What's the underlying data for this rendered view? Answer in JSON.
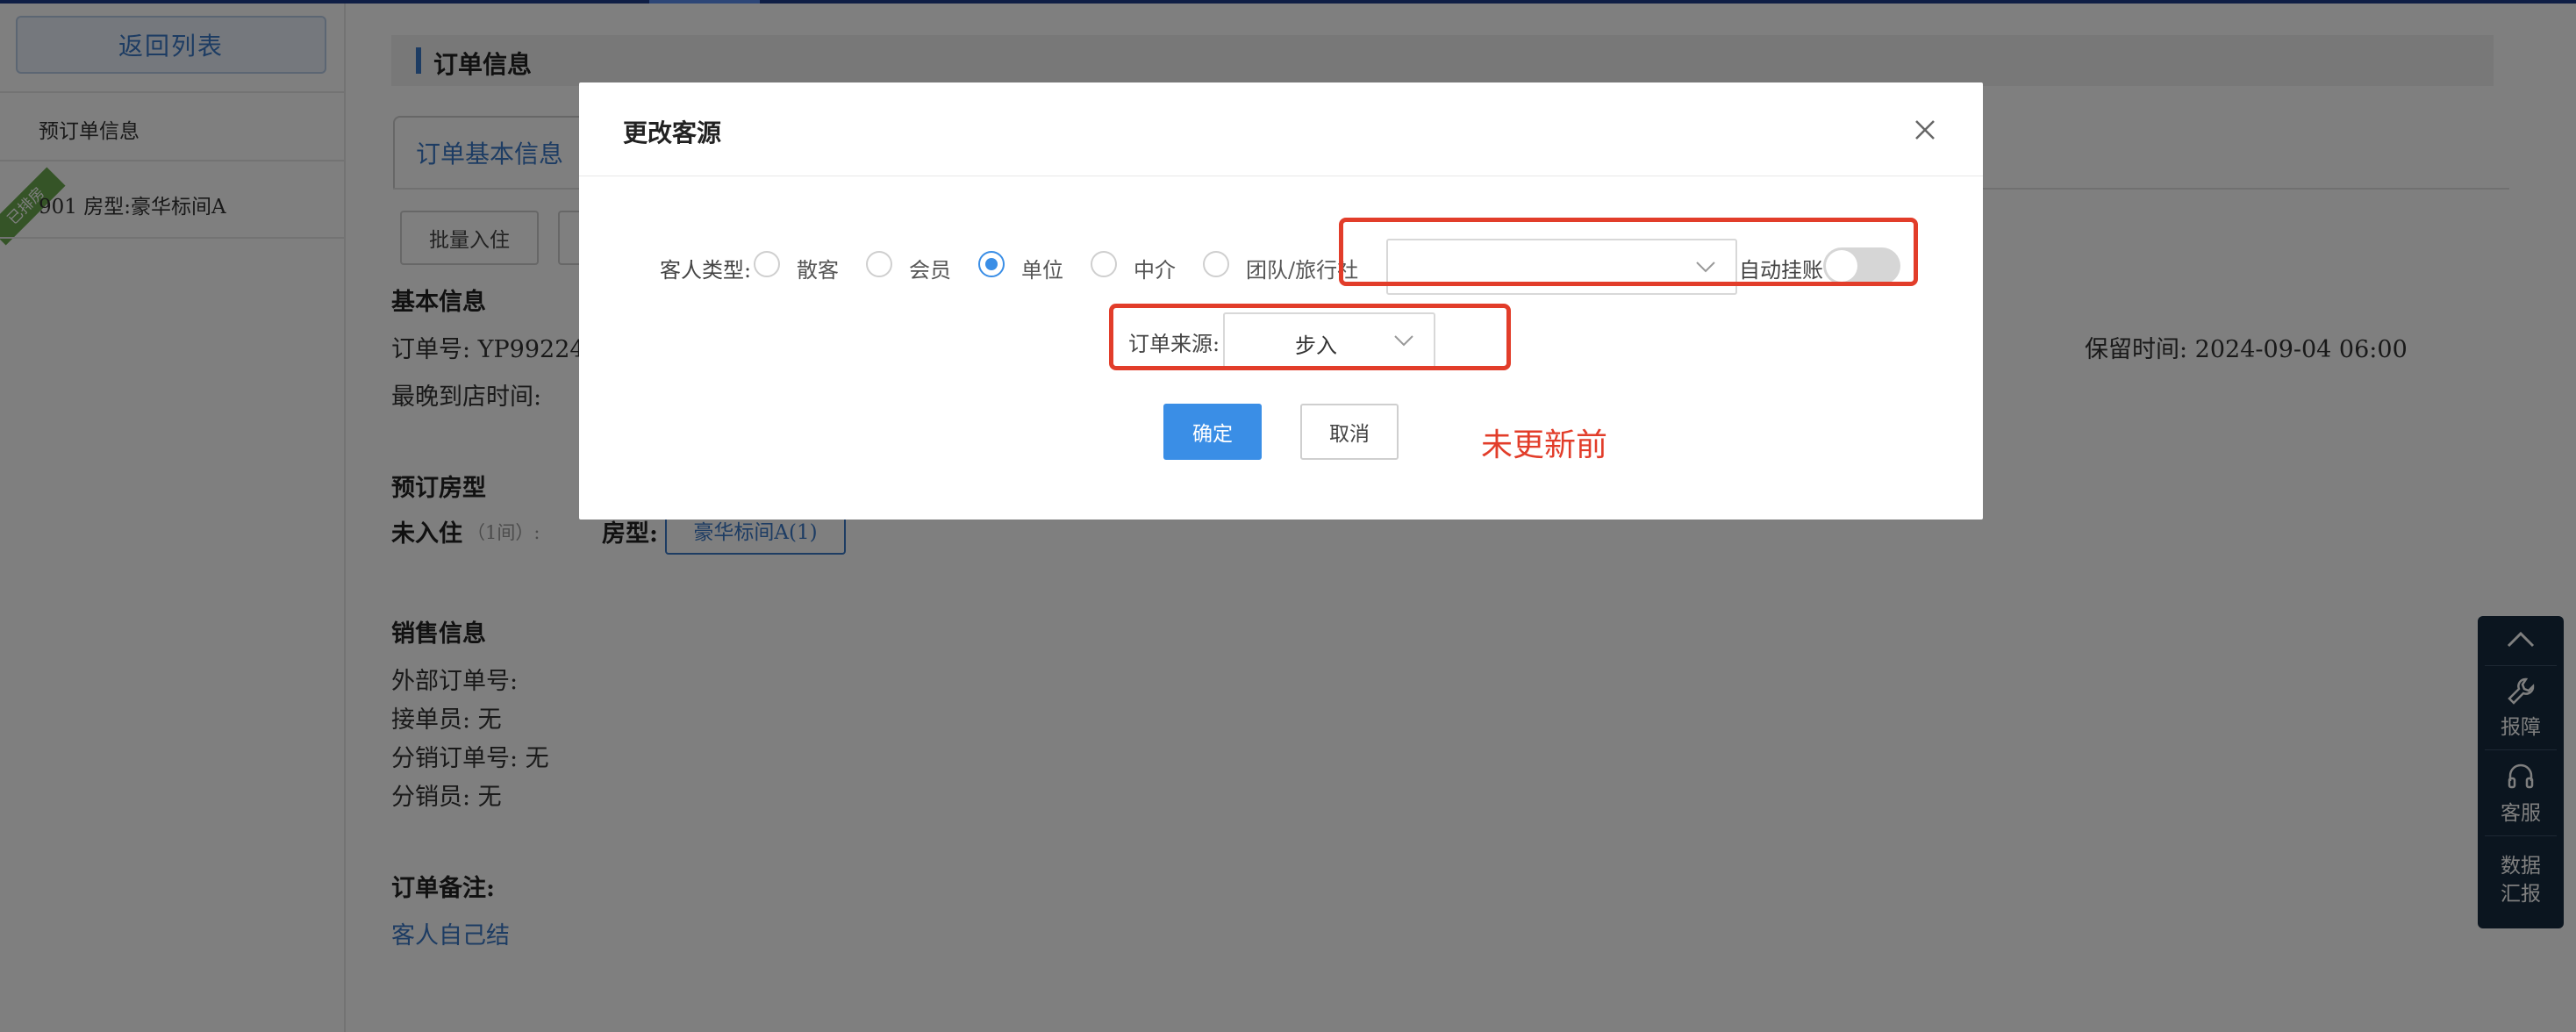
{
  "sidebar": {
    "back_label": "返回列表",
    "section_label": "预订单信息",
    "room_item": "901  房型:豪华标间A",
    "ribbon_label": "已排房"
  },
  "main": {
    "section_title": "订单信息",
    "tab_label": "订单基本信息",
    "batch_checkin_label": "批量入住",
    "basic_info_title": "基本信息",
    "order_no_label": "订单号: YP99224",
    "latest_arrival_label": "最晚到店时间:",
    "retain_time_label": "保留时间: 2024-09-04 06:00",
    "booked_room_title": "预订房型",
    "not_checked_in_label": "未入住",
    "room_count_label": "（1间）:",
    "room_type_label": "房型:",
    "room_tag": "豪华标间A(1)",
    "sales_info_title": "销售信息",
    "external_order_label": "外部订单号:",
    "receiver_label": "接单员: 无",
    "distribution_order_label": "分销订单号:  无",
    "distributor_label": "分销员: 无",
    "remark_title": "订单备注:",
    "remark_value": "客人自己结"
  },
  "float_bar": {
    "report_label": "报障",
    "service_label": "客服",
    "data_label_1": "数据",
    "data_label_2": "汇报"
  },
  "dialog": {
    "title": "更改客源",
    "guest_type_label": "客人类型:",
    "guest_types": [
      "散客",
      "会员",
      "单位",
      "中介",
      "团队/旅行社"
    ],
    "selected_guest_type": "单位",
    "unit_select_value": "",
    "auto_charge_label": "自动挂账",
    "auto_charge_on": false,
    "order_source_label": "订单来源:",
    "order_source_value": "步入",
    "confirm_label": "确定",
    "cancel_label": "取消"
  },
  "annotation": {
    "note": "未更新前"
  },
  "colors": {
    "primary": "#3a8ee6",
    "highlight": "#e23d2a",
    "link": "#3a78c6",
    "float_bar_bg": "#162a3e"
  }
}
